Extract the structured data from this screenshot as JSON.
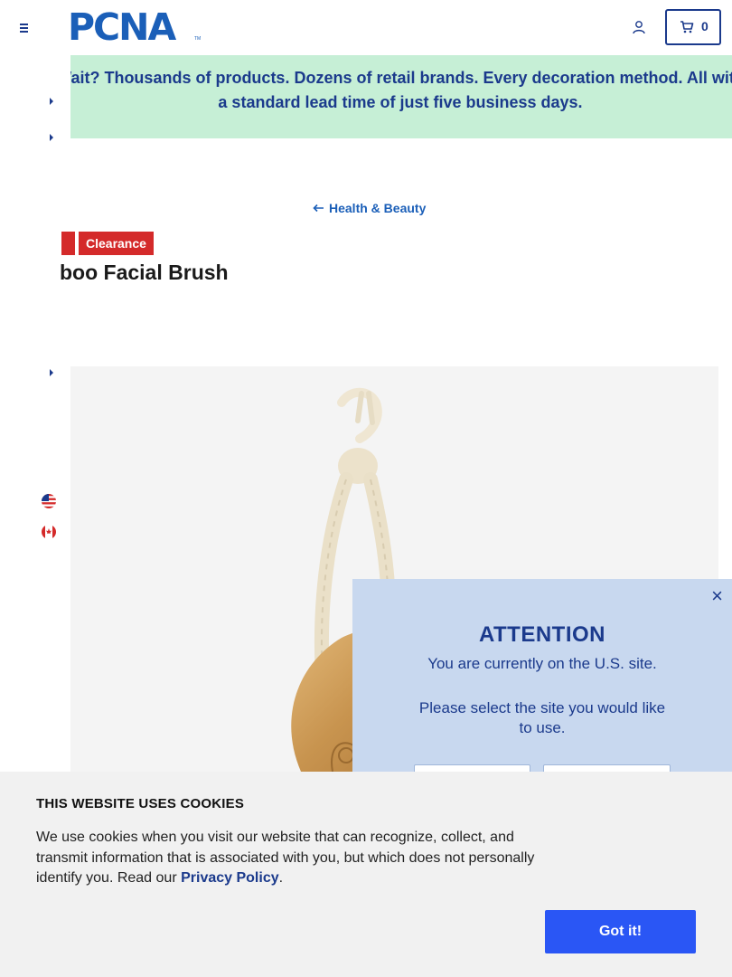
{
  "header": {
    "logo_text": "PCNA",
    "logo_tm": "TM",
    "cart_count": "0"
  },
  "promo": {
    "text": "Wait? Thousands of products. Dozens of retail brands. Every decoration method. All with a standard lead time of just five business days."
  },
  "breadcrumb": {
    "label": "Health & Beauty"
  },
  "product": {
    "badge": "Clearance",
    "title": "boo Facial Brush"
  },
  "locale": {
    "options": [
      "us-flag-icon",
      "canada-flag-icon"
    ]
  },
  "modal": {
    "close_label": "×",
    "title": "ATTENTION",
    "line1": "You are currently on the U.S. site.",
    "line2": "Please select the site you would like to use."
  },
  "cookie": {
    "title": "THIS WEBSITE USES COOKIES",
    "text_before": "We use cookies when you visit our website that can recognize, collect, and transmit information that is associated with you, but which does not personally identify you. Read our ",
    "link": "Privacy Policy",
    "text_after": ".",
    "button": "Got it!"
  },
  "colors": {
    "brand_blue": "#1b5fb8",
    "navy": "#1b3a8c",
    "promo_bg": "#c6efd6",
    "badge_red": "#d42a2a",
    "modal_bg": "#c8d8ef",
    "cookie_button": "#2a56f5"
  }
}
